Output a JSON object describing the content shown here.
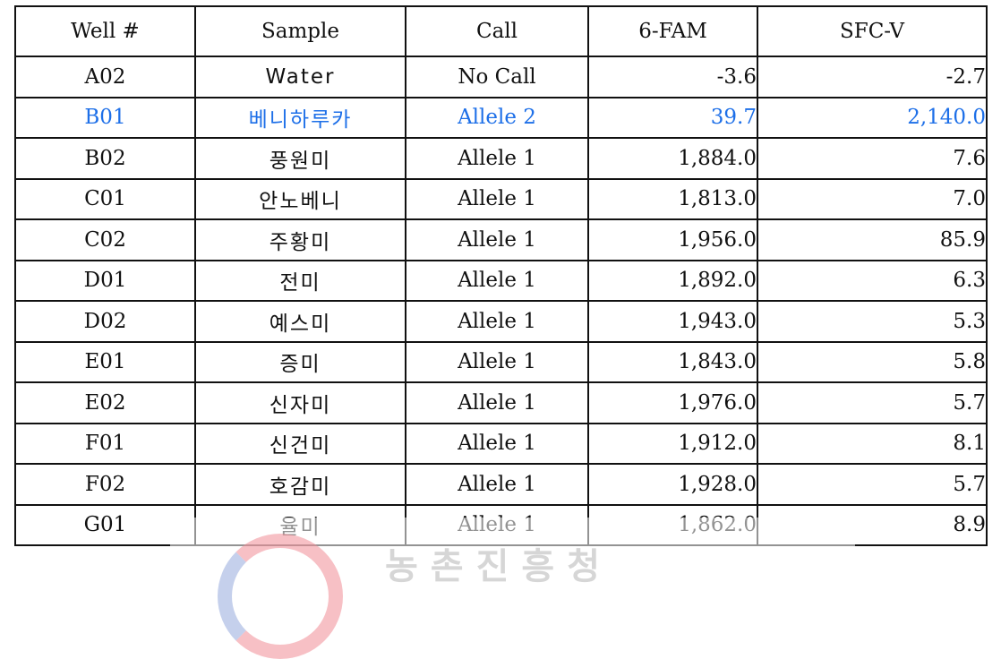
{
  "table": {
    "headers": [
      "Well #",
      "Sample",
      "Call",
      "6-FAM",
      "SFC-V"
    ],
    "rows": [
      {
        "well": "A02",
        "sample": "Water",
        "call": "No Call",
        "fam": "-3.6",
        "sfcv": "-2.7"
      },
      {
        "well": "B01",
        "sample": "베니하루카",
        "call": "Allele 2",
        "fam": "39.7",
        "sfcv": "2,140.0"
      },
      {
        "well": "B02",
        "sample": "풍원미",
        "call": "Allele 1",
        "fam": "1,884.0",
        "sfcv": "7.6"
      },
      {
        "well": "C01",
        "sample": "안노베니",
        "call": "Allele 1",
        "fam": "1,813.0",
        "sfcv": "7.0"
      },
      {
        "well": "C02",
        "sample": "주황미",
        "call": "Allele 1",
        "fam": "1,956.0",
        "sfcv": "85.9"
      },
      {
        "well": "D01",
        "sample": "전미",
        "call": "Allele 1",
        "fam": "1,892.0",
        "sfcv": "6.3"
      },
      {
        "well": "D02",
        "sample": "예스미",
        "call": "Allele 1",
        "fam": "1,943.0",
        "sfcv": "5.3"
      },
      {
        "well": "E01",
        "sample": "증미",
        "call": "Allele 1",
        "fam": "1,843.0",
        "sfcv": "5.8"
      },
      {
        "well": "E02",
        "sample": "신자미",
        "call": "Allele 1",
        "fam": "1,976.0",
        "sfcv": "5.7"
      },
      {
        "well": "F01",
        "sample": "신건미",
        "call": "Allele 1",
        "fam": "1,912.0",
        "sfcv": "8.1"
      },
      {
        "well": "F02",
        "sample": "호감미",
        "call": "Allele 1",
        "fam": "1,928.0",
        "sfcv": "5.7"
      },
      {
        "well": "G01",
        "sample": "율미",
        "call": "Allele 1",
        "fam": "1,862.0",
        "sfcv": "8.9"
      }
    ],
    "highlight_row": "B01",
    "highlight_color": "#1d6fe8"
  },
  "watermark": {
    "text": "농촌진흥청",
    "icon": "rda-logo-icon"
  }
}
